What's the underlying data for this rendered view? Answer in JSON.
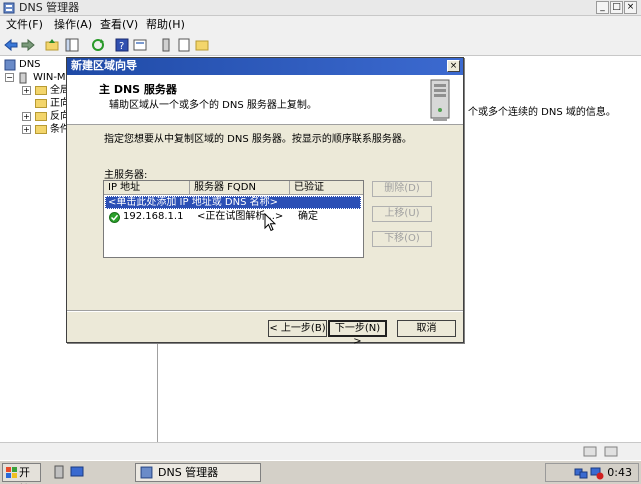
{
  "window": {
    "title": "DNS 管理器",
    "min_label": "_",
    "max_label": "□",
    "close_label": "×"
  },
  "menu": {
    "items": [
      "文件(F)",
      "操作(A)",
      "查看(V)",
      "帮助(H)"
    ]
  },
  "tree": {
    "root": "DNS",
    "server": "WIN-ME",
    "items": [
      "全局",
      "正向",
      "反向",
      "条件"
    ]
  },
  "right_pane": {
    "partial_text": "个或多个连续的 DNS 域的信息。"
  },
  "wizard": {
    "title": "新建区域向导",
    "close_label": "×",
    "header_title": "主 DNS 服务器",
    "header_subtitle": "辅助区域从一个或多个的 DNS 服务器上复制。",
    "instruction": "指定您想要从中复制区域的 DNS 服务器。按显示的顺序联系服务器。",
    "master_label": "主服务器:",
    "columns": [
      "IP 地址",
      "服务器 FQDN",
      "已验证"
    ],
    "add_row_text": "<单击此处添加 IP 地址或 DNS 名称>",
    "rows": [
      {
        "ip": "192.168.1.1",
        "fqdn": "<正在试图解析...>",
        "verified": "确定"
      }
    ],
    "buttons": {
      "delete": "删除(D)",
      "move_up": "上移(U)",
      "move_down": "下移(O)",
      "back": "< 上一步(B)",
      "next": "下一步(N) >",
      "cancel": "取消"
    }
  },
  "taskbar": {
    "start": "开始",
    "task": "DNS 管理器",
    "clock": "0:43"
  },
  "colors": {
    "wizard_titlebar": "#1f4aa6",
    "selection": "#2b4fb5",
    "check_green": "#2aa02a"
  }
}
